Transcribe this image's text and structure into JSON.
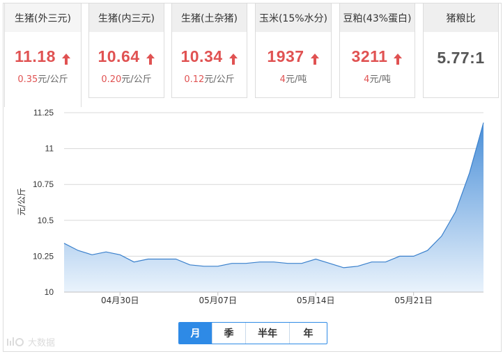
{
  "cards": [
    {
      "title": "生猪(外三元)",
      "price": "11.18",
      "change_value": "0.35",
      "change_unit": "元/公斤",
      "trend": "up"
    },
    {
      "title": "生猪(内三元)",
      "price": "10.64",
      "change_value": "0.20",
      "change_unit": "元/公斤",
      "trend": "up"
    },
    {
      "title": "生猪(土杂猪)",
      "price": "10.34",
      "change_value": "0.12",
      "change_unit": "元/公斤",
      "trend": "up"
    },
    {
      "title": "玉米(15%水分)",
      "price": "1937",
      "change_value": "4",
      "change_unit": "元/吨",
      "trend": "up"
    },
    {
      "title": "豆粕(43%蛋白)",
      "price": "3211",
      "change_value": "4",
      "change_unit": "元/吨",
      "trend": "up"
    },
    {
      "title": "猪粮比",
      "price": "5.77:1"
    }
  ],
  "colors": {
    "up": "#e05252",
    "line": "#3a80cc",
    "fill_top": "#4a8fd8",
    "fill_bottom": "#eaf3fc",
    "grid": "#d8d8d8",
    "accent": "#2e8ae6"
  },
  "chart_data": {
    "type": "area",
    "ylabel": "元/公斤",
    "ylim": [
      10,
      11.25
    ],
    "yticks": [
      "10",
      "10.25",
      "10.5",
      "10.75",
      "11",
      "11.25"
    ],
    "xticks": [
      {
        "label": "04月30日",
        "index": 4
      },
      {
        "label": "05月07日",
        "index": 11
      },
      {
        "label": "05月14日",
        "index": 18
      },
      {
        "label": "05月21日",
        "index": 25
      }
    ],
    "values": [
      10.34,
      10.29,
      10.26,
      10.28,
      10.26,
      10.21,
      10.23,
      10.23,
      10.23,
      10.19,
      10.18,
      10.18,
      10.2,
      10.2,
      10.21,
      10.21,
      10.2,
      10.2,
      10.23,
      10.2,
      10.17,
      10.18,
      10.21,
      10.21,
      10.25,
      10.25,
      10.29,
      10.39,
      10.56,
      10.83,
      11.18
    ],
    "grid": true,
    "legend": "none"
  },
  "range_tabs": [
    "月",
    "季",
    "半年",
    "年"
  ],
  "range_selected": "月",
  "watermark": "大数据"
}
